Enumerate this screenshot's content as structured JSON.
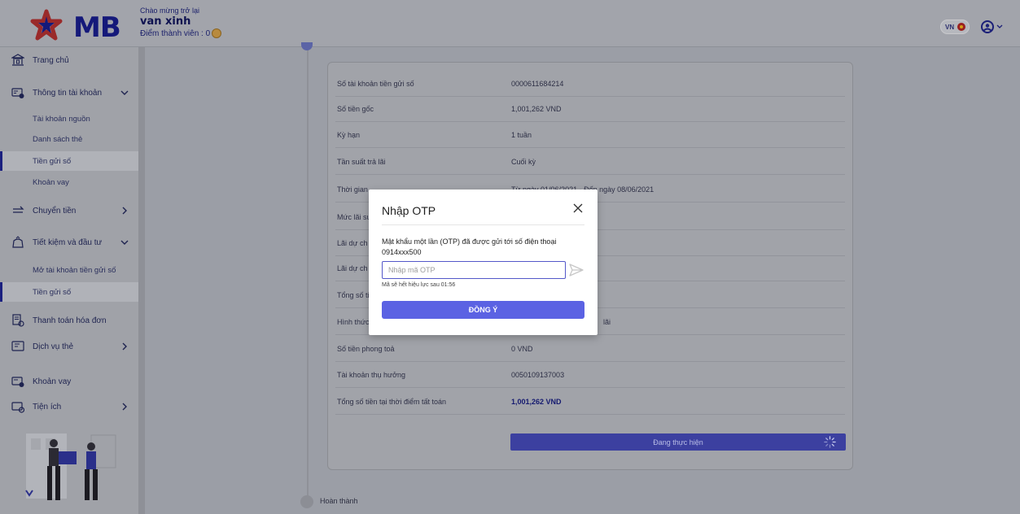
{
  "header": {
    "logo_text": "MB",
    "welcome": "Chào mừng trở lại",
    "user_name": "van xinh",
    "member_points_label": "Điểm thành viên : 0",
    "lang": "VN",
    "colors": {
      "brand": "#15197a",
      "accent": "#5b62e3"
    }
  },
  "sidebar": {
    "home": "Trang chủ",
    "account_info": "Thông tin tài khoản",
    "account_sub": [
      "Tài khoản nguồn",
      "Danh sách thẻ",
      "Tiền gửi số",
      "Khoản vay"
    ],
    "transfer": "Chuyển tiền",
    "savings": "Tiết kiệm và đầu tư",
    "savings_sub": [
      "Mở tài khoản tiền gửi số",
      "Tiền gửi số"
    ],
    "bill_pay": "Thanh toán hóa đơn",
    "card_service": "Dịch vụ thẻ",
    "loans": "Khoản vay",
    "utilities": "Tiện ích"
  },
  "details": {
    "rows": [
      {
        "label": "Số tài khoản tiền gửi số",
        "value": "0000611684214"
      },
      {
        "label": "Số tiền gốc",
        "value": "1,001,262 VND"
      },
      {
        "label": "Kỳ hạn",
        "value": "1 tuần"
      },
      {
        "label": "Tần suất trả lãi",
        "value": "Cuối kỳ"
      },
      {
        "label": "Thời gian",
        "value": "Từ ngày 01/06/2021 - Đến ngày 08/06/2021"
      },
      {
        "label": "Mức lãi su",
        "value": ""
      },
      {
        "label": "Lãi dự ch",
        "value": ""
      },
      {
        "label": "Lãi dự ch",
        "value": ""
      },
      {
        "label": "Tổng số ti",
        "value": ""
      },
      {
        "label": "Hình thức",
        "value": "lãi"
      },
      {
        "label": "Số tiền phong toả",
        "value": "0 VND"
      },
      {
        "label": "Tài khoản thụ hưởng",
        "value": "0050109137003"
      },
      {
        "label": "Tổng số tiền tại thời điểm tất toán",
        "value": "1,001,262 VND"
      }
    ],
    "processing_button": "Đang thực hiện",
    "done_step": "Hoàn thành"
  },
  "otp_modal": {
    "title": "Nhập OTP",
    "description": "Mật khẩu một lần (OTP) đã được gửi tới số điện thoại 0914xxx500",
    "input_placeholder": "Nhập mã OTP",
    "input_value": "",
    "expiry_hint": "Mã sẽ hết hiệu lực sau 01:56",
    "confirm_label": "ĐỒNG Ý"
  },
  "icons": [
    "bank-icon",
    "card-icon",
    "transfer-icon",
    "piggy-icon",
    "bill-icon",
    "card-service-icon",
    "loan-icon",
    "utility-icon",
    "chevron-down-icon",
    "chevron-right-icon",
    "close-icon",
    "send-icon",
    "user-icon",
    "spinner-icon"
  ]
}
